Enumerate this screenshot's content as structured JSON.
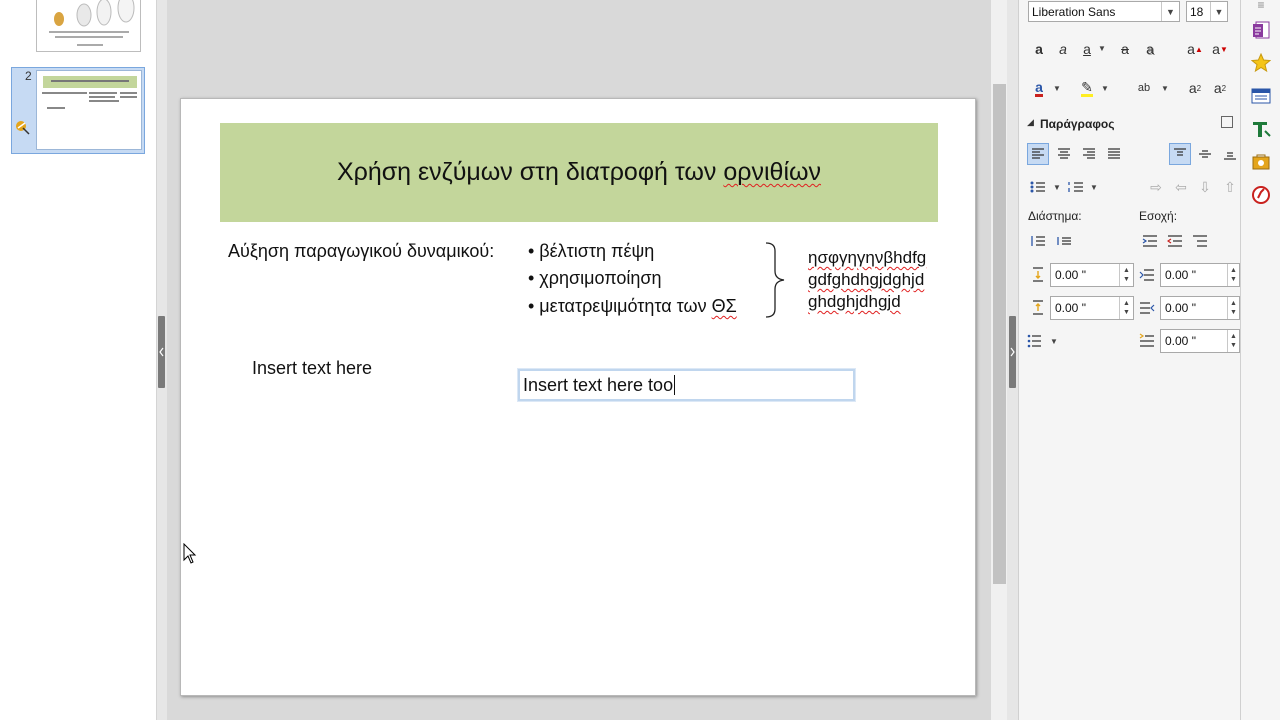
{
  "slide_panel": {
    "slide2_number": "2"
  },
  "slide": {
    "title": "Χρήση ενζύμων στη διατροφή των ορνιθίων",
    "title_plain": "Χρήση ενζύμων στη διατροφή των ",
    "title_underlined": "ορνιθίων",
    "lead": "Αύξηση παραγωγικού δυναμικού:",
    "bullets": [
      "• βέλτιστη πέψη",
      "• χρησιμοποίηση",
      "• μετατρεψιμότητα των ΘΣ"
    ],
    "bullet3_plain": "• μετατρεψιμότητα των ",
    "bullet3_underlined": "ΘΣ",
    "side_text": [
      "ησφγηγηνβhdfg",
      "gdfghdhgjdghjd",
      "ghdghjdhgjd"
    ],
    "text1": "Insert text here",
    "text2": "Insert text here too"
  },
  "sidebar": {
    "font_name": "Liberation Sans",
    "font_size": "18",
    "paragraph_title": "Παράγραφος",
    "spacing_label": "Διάστημα:",
    "indent_label": "Εσοχή:",
    "spacing_above": "0.00 \"",
    "spacing_below": "0.00 \"",
    "indent_before": "0.00 \"",
    "indent_after": "0.00 \"",
    "indent_first": "0.00 \""
  },
  "colors": {
    "title_fill": "#c3d69b",
    "selection": "#c6daf3",
    "spell_error": "#e02020"
  }
}
